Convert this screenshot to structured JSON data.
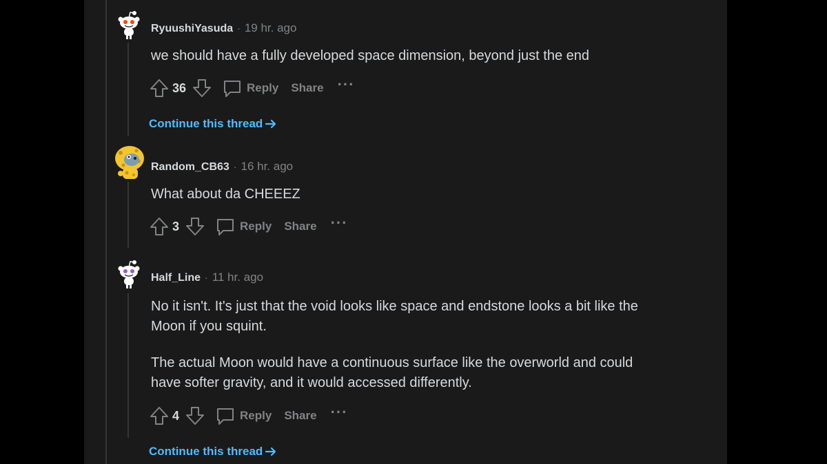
{
  "comments": [
    {
      "username": "RyuushiYasuda",
      "separator": "·",
      "time": "19 hr. ago",
      "paragraphs": [
        "we should have a fully developed space dimension, beyond just the end"
      ],
      "score": "36",
      "reply_label": "Reply",
      "share_label": "Share",
      "more_label": "···",
      "continue_label": "Continue this thread"
    },
    {
      "username": "Random_CB63",
      "separator": "·",
      "time": "16 hr. ago",
      "paragraphs": [
        "What about da CHEEEZ"
      ],
      "score": "3",
      "reply_label": "Reply",
      "share_label": "Share",
      "more_label": "···"
    },
    {
      "username": "Half_Line",
      "separator": "·",
      "time": "11 hr. ago",
      "paragraphs": [
        "No it isn't. It's just that the void looks like space and endstone looks a bit like the Moon if you squint.",
        "The actual Moon would have a continuous surface like the overworld and could have softer gravity, and it would accessed differently."
      ],
      "score": "4",
      "reply_label": "Reply",
      "share_label": "Share",
      "more_label": "···",
      "continue_label": "Continue this thread"
    }
  ],
  "colors": {
    "background": "#1a1a1b",
    "text": "#d7dadc",
    "muted": "#818384",
    "link": "#4fbcff"
  },
  "icons": [
    "snoo-avatar-icon",
    "cheese-mascot-avatar-icon",
    "upvote-icon",
    "downvote-icon",
    "comment-icon",
    "arrow-right-icon"
  ]
}
